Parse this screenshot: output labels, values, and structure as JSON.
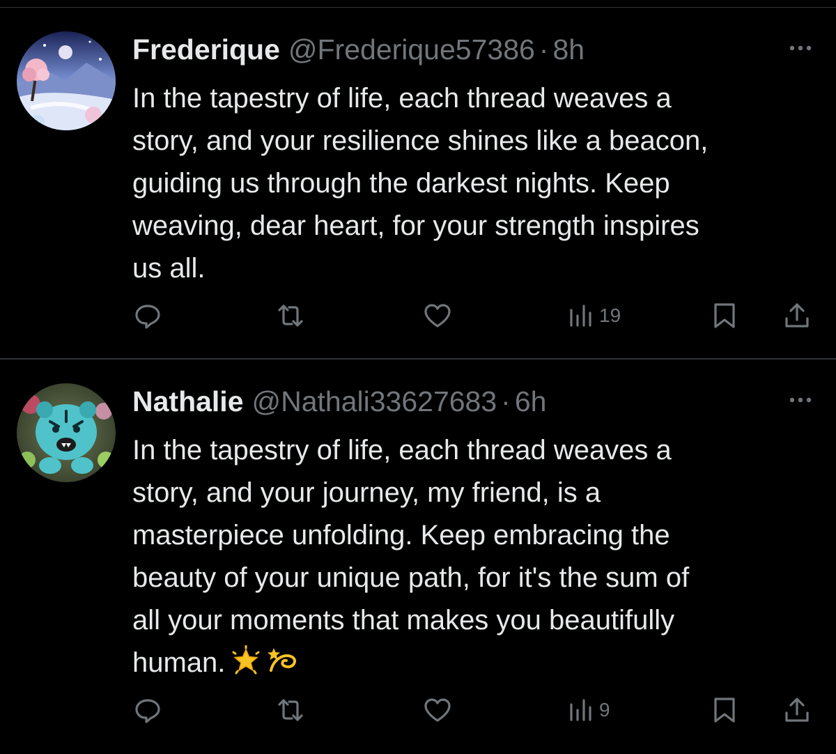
{
  "posts": [
    {
      "display_name": "Frederique",
      "handle": "@Frederique57386",
      "separator": "·",
      "time": "8h",
      "text": "In the tapestry of life, each thread weaves a\nstory, and your resilience shines like a beacon,\nguiding us through the darkest nights. Keep\nweaving, dear heart, for your strength inspires\nus all.",
      "emojis": [],
      "actions": {
        "reply_icon": "reply-icon",
        "repost_icon": "repost-icon",
        "like_icon": "heart-icon",
        "views_icon": "analytics-icon",
        "views": "19",
        "bookmark_icon": "bookmark-icon",
        "share_icon": "share-icon"
      },
      "avatar": "landscape-avatar"
    },
    {
      "display_name": "Nathalie",
      "handle": "@Nathali33627683",
      "separator": "·",
      "time": "6h",
      "text": "In the tapestry of life, each thread weaves a\nstory, and your journey, my friend, is a\nmasterpiece unfolding. Keep embracing the\nbeauty of your unique path, for it's the sum of\nall your moments that makes you beautifully\nhuman.",
      "emojis": [
        "glowing-star-emoji",
        "dizzy-emoji"
      ],
      "actions": {
        "reply_icon": "reply-icon",
        "repost_icon": "repost-icon",
        "like_icon": "heart-icon",
        "views_icon": "analytics-icon",
        "views": "9",
        "bookmark_icon": "bookmark-icon",
        "share_icon": "share-icon"
      },
      "avatar": "tiger-avatar"
    }
  ],
  "colors": {
    "background": "#000000",
    "primary_text": "#e7e9ea",
    "secondary_text": "#71767b",
    "divider": "#2f3336"
  }
}
